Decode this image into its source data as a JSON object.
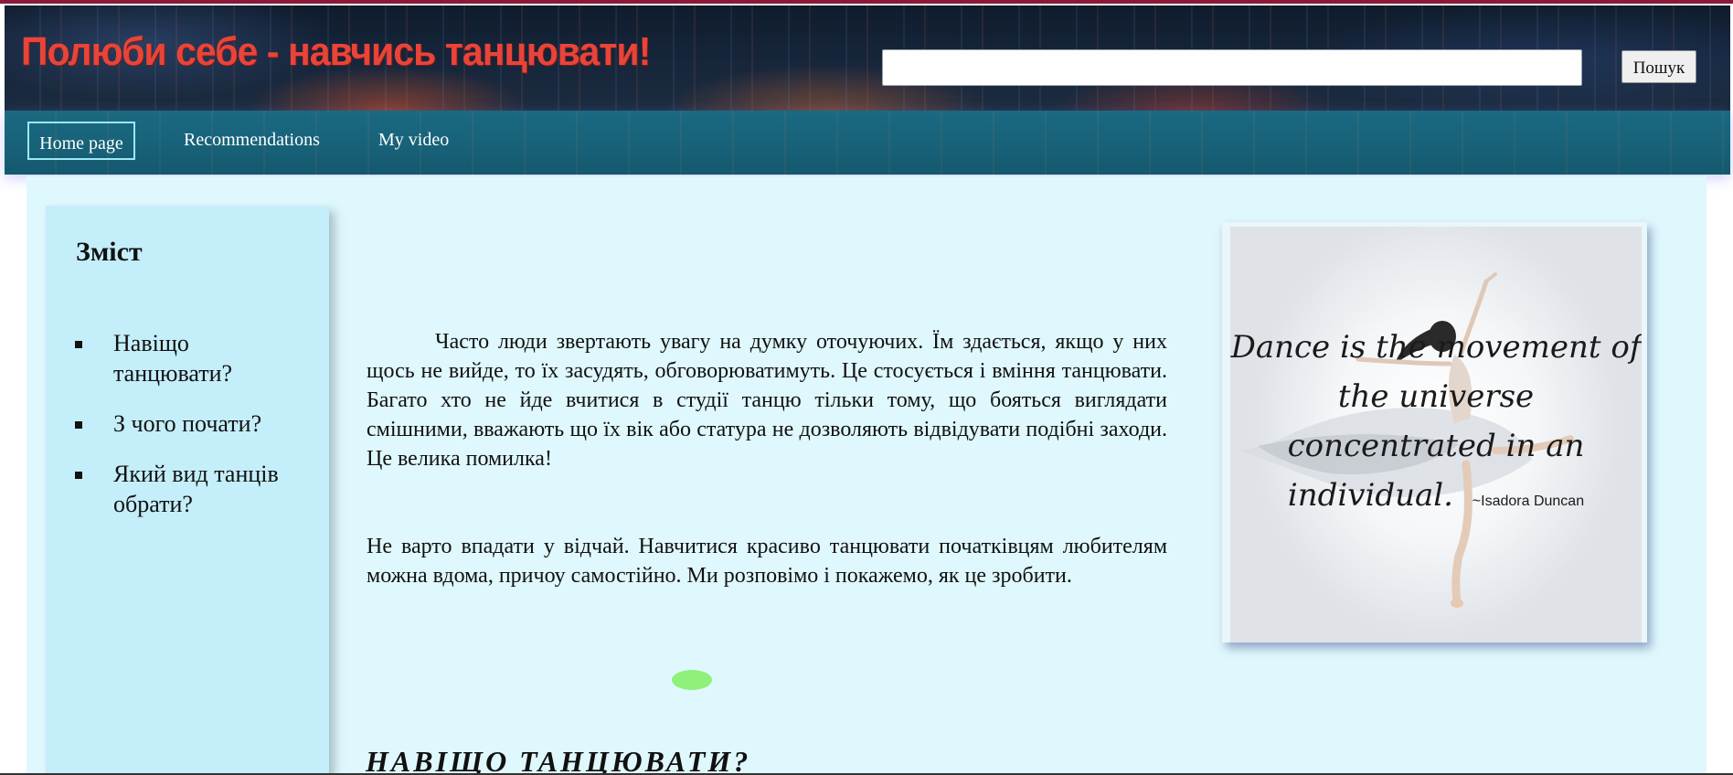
{
  "header": {
    "site_title": "Полюби себе - навчись танцювати!",
    "search_placeholder": "",
    "search_button": "Пошук"
  },
  "nav": {
    "items": [
      {
        "label": "Home page",
        "active": true
      },
      {
        "label": "Recommendations",
        "active": false
      },
      {
        "label": "My video",
        "active": false
      }
    ]
  },
  "sidebar": {
    "title": "Зміст",
    "items": [
      {
        "label": "Навіщо танцювати?"
      },
      {
        "label": "З чого почати?"
      },
      {
        "label": "Який вид танців обрати?"
      }
    ]
  },
  "main": {
    "paragraph_1": "Часто люди звертають увагу на думку оточуючих. Їм здається, якщо у них щось не вийде, то їх засудять, обговорюватимуть. Це стосується і вміння танцювати. Багато хто не йде вчитися в студії танцю тільки тому, що бояться виглядати смішними, вважають що їх вік або статура не дозволяють відвідувати подібні заходи. Це велика помилка!",
    "paragraph_2": "Не варто впадати у відчай. Навчитися красиво танцювати початківцям любителям можна вдома, причоу самостійно. Ми розповімо і покажемо, як це зробити.",
    "section_heading": "НАВІЩО ТАНЦЮВАТИ?"
  },
  "image_card": {
    "quote": "Dance is the movement of the universe concentrated in an individual.",
    "author": "~Isadora Duncan"
  },
  "colors": {
    "title_red": "#e8443a",
    "nav_teal": "#176178",
    "content_bg": "#dff8fd",
    "sidebar_bg": "#c4eef9",
    "accent_green": "#8ff07a"
  }
}
